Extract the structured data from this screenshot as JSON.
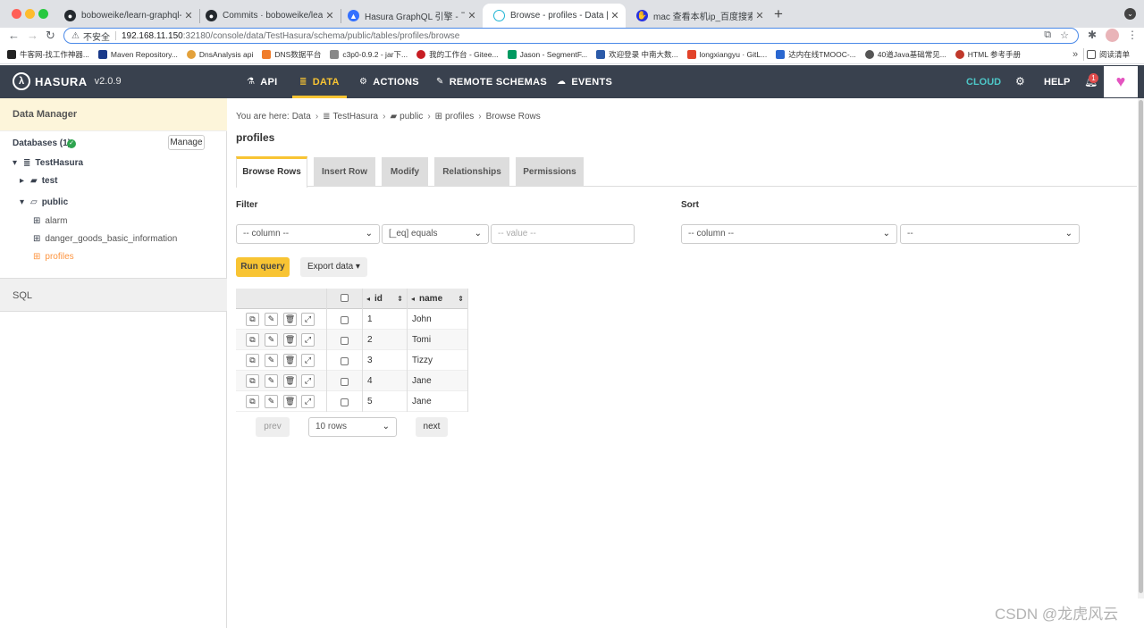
{
  "browser": {
    "tabs": [
      {
        "label": "boboweike/learn-graphql-sprin",
        "icon": "github-icon",
        "active": false
      },
      {
        "label": "Commits · boboweike/learn-gr",
        "icon": "github-icon",
        "active": false
      },
      {
        "label": "Hasura GraphQL 引擎 - 飞书云",
        "icon": "feishu-icon",
        "active": false
      },
      {
        "label": "Browse - profiles - Data | Hasu",
        "icon": "hasura-icon",
        "active": true
      },
      {
        "label": "mac 查看本机ip_百度搜索",
        "icon": "baidu-icon",
        "active": false
      }
    ],
    "tab_close": "✕",
    "new_tab": "+",
    "url_warning": "不安全",
    "url_host": "192.168.11.150",
    "url_path": ":32180/console/data/TestHasura/schema/public/tables/profiles/browse",
    "bookmarks": [
      {
        "label": "牛客网-找工作神器...",
        "color": "#222222"
      },
      {
        "label": "Maven Repository...",
        "color": "#1a3a8a"
      },
      {
        "label": "DnsAnalysis api",
        "color": "#e3a13b"
      },
      {
        "label": "DNS数据平台",
        "color": "#f07c2a"
      },
      {
        "label": "c3p0-0.9.2 - jar下...",
        "color": "#888888"
      },
      {
        "label": "我的工作台 - Gitee...",
        "color": "#c71d23"
      },
      {
        "label": "Jason - SegmentF...",
        "color": "#009a61"
      },
      {
        "label": "欢迎登录 中南大数...",
        "color": "#2b5aa8"
      },
      {
        "label": "longxiangyu · GitL...",
        "color": "#e24329"
      },
      {
        "label": "达内在线TMOOC-...",
        "color": "#2a67d0"
      },
      {
        "label": "40道Java基础常见...",
        "color": "#555555"
      },
      {
        "label": "HTML 参考手册",
        "color": "#c0392b"
      }
    ],
    "more_bookmarks": "»",
    "reading_list": "阅读清单"
  },
  "hasura": {
    "brand": "HASURA",
    "version": "v2.0.9",
    "nav": [
      {
        "label": "API",
        "icon": "flask-icon",
        "active": false
      },
      {
        "label": "DATA",
        "icon": "database-icon",
        "active": true
      },
      {
        "label": "ACTIONS",
        "icon": "cogs-icon",
        "active": false
      },
      {
        "label": "REMOTE SCHEMAS",
        "icon": "plug-icon",
        "active": false
      },
      {
        "label": "EVENTS",
        "icon": "cloud-icon",
        "active": false
      }
    ],
    "cloud": "CLOUD",
    "help": "HELP",
    "notifications": "1",
    "accent": "#f8c433",
    "active_link": "#fd9540"
  },
  "sidebar": {
    "title": "Data Manager",
    "databases_label": "Databases (1)",
    "manage_label": "Manage",
    "database": "TestHasura",
    "schemas": [
      "test",
      "public"
    ],
    "tables": [
      "alarm",
      "danger_goods_basic_information",
      "profiles"
    ],
    "active_table": "profiles",
    "sql_label": "SQL"
  },
  "main": {
    "breadcrumb": {
      "prefix": "You are here:",
      "data": "Data",
      "database": "TestHasura",
      "schema": "public",
      "table": "profiles",
      "page": "Browse Rows"
    },
    "title": "profiles",
    "tabs": [
      "Browse Rows",
      "Insert Row",
      "Modify",
      "Relationships",
      "Permissions"
    ],
    "active_tab": "Browse Rows",
    "filter_label": "Filter",
    "sort_label": "Sort",
    "filter_column": "-- column --",
    "filter_operator": "[_eq] equals",
    "filter_value_placeholder": "-- value --",
    "sort_column": "-- column --",
    "sort_order": "--",
    "run_query": "Run query",
    "export_data": "Export data ▾"
  },
  "table": {
    "columns": [
      "id",
      "name"
    ],
    "rows": [
      {
        "id": "1",
        "name": "John"
      },
      {
        "id": "2",
        "name": "Tomi"
      },
      {
        "id": "3",
        "name": "Tizzy"
      },
      {
        "id": "4",
        "name": "Jane"
      },
      {
        "id": "5",
        "name": "Jane"
      }
    ]
  },
  "pagination": {
    "prev": "prev",
    "rows_option": "10 rows",
    "next": "next"
  },
  "watermark": "CSDN @龙虎风云"
}
